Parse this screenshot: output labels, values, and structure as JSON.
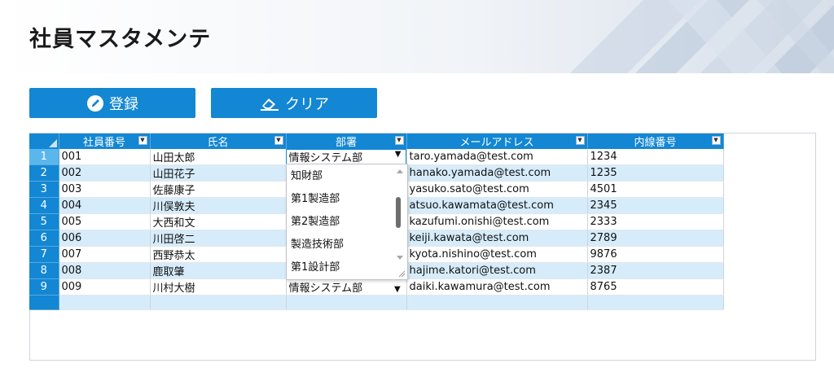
{
  "page": {
    "title": "社員マスタメンテ"
  },
  "toolbar": {
    "register_label": "登録",
    "clear_label": "クリア",
    "accent_color": "#1387d3"
  },
  "grid": {
    "columns": [
      "社員番号",
      "氏名",
      "部署",
      "メールアドレス",
      "内線番号"
    ],
    "rows": [
      {
        "no": "1",
        "id": "001",
        "name": "山田太郎",
        "dept": "情報システム部",
        "email": "taro.yamada@test.com",
        "ext": "1234"
      },
      {
        "no": "2",
        "id": "002",
        "name": "山田花子",
        "dept": "",
        "email": "hanako.yamada@test.com",
        "ext": "1235"
      },
      {
        "no": "3",
        "id": "003",
        "name": "佐藤康子",
        "dept": "",
        "email": "yasuko.sato@test.com",
        "ext": "4501"
      },
      {
        "no": "4",
        "id": "004",
        "name": "川俣敦夫",
        "dept": "",
        "email": "atsuo.kawamata@test.com",
        "ext": "2345"
      },
      {
        "no": "5",
        "id": "005",
        "name": "大西和文",
        "dept": "",
        "email": "kazufumi.onishi@test.com",
        "ext": "2333"
      },
      {
        "no": "6",
        "id": "006",
        "name": "川田啓二",
        "dept": "",
        "email": "keiji.kawata@test.com",
        "ext": "2789"
      },
      {
        "no": "7",
        "id": "007",
        "name": "西野恭太",
        "dept": "",
        "email": "kyota.nishino@test.com",
        "ext": "9876"
      },
      {
        "no": "8",
        "id": "008",
        "name": "鹿取肇",
        "dept": "",
        "email": "hajime.katori@test.com",
        "ext": "2387"
      },
      {
        "no": "9",
        "id": "009",
        "name": "川村大樹",
        "dept": "情報システム部",
        "email": "daiki.kawamura@test.com",
        "ext": "8765"
      }
    ]
  },
  "dropdown": {
    "options": [
      "知財部",
      "第1製造部",
      "第2製造部",
      "製造技術部",
      "第1設計部"
    ]
  },
  "icons": {
    "register": "pencil-icon",
    "clear": "eraser-icon",
    "filter": "filter-dropdown-icon"
  }
}
